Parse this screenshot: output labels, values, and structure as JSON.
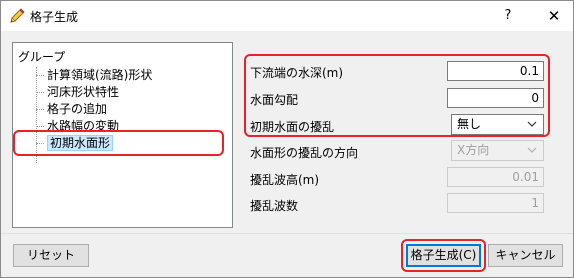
{
  "window": {
    "title": "格子生成",
    "help_label": "?",
    "close_label": "✕",
    "icon": "pencil-icon"
  },
  "tree": {
    "root_label": "グループ",
    "items": [
      {
        "label": "計算領域(流路)形状",
        "selected": false
      },
      {
        "label": "河床形状特性",
        "selected": false
      },
      {
        "label": "格子の追加",
        "selected": false
      },
      {
        "label": "水路幅の変動",
        "selected": false
      },
      {
        "label": "初期水面形",
        "selected": true
      }
    ]
  },
  "form": {
    "downstream_depth_label": "下流端の水深(m)",
    "downstream_depth_value": "0.1",
    "surface_slope_label": "水面勾配",
    "surface_slope_value": "0",
    "initial_disturbance_label": "初期水面の擾乱",
    "initial_disturbance_value": "無し",
    "disturbance_direction_label": "水面形の擾乱の方向",
    "disturbance_direction_value": "X方向",
    "disturbance_amplitude_label": "擾乱波高(m)",
    "disturbance_amplitude_value": "0.01",
    "disturbance_wavenumber_label": "擾乱波数",
    "disturbance_wavenumber_value": "1"
  },
  "buttons": {
    "reset_label": "リセット",
    "generate_label": "格子生成(C)",
    "cancel_label": "キャンセル"
  },
  "colors": {
    "highlight": "#e8222a",
    "selection": "#cce8ff",
    "default_button_border": "#0078d7"
  }
}
